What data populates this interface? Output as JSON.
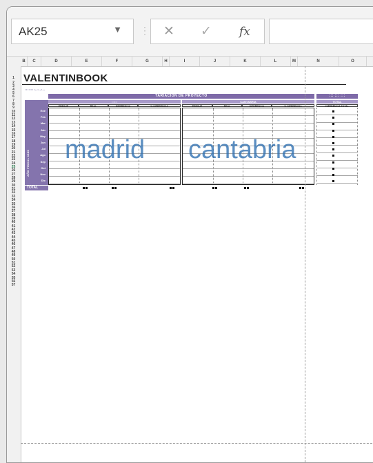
{
  "formula_bar": {
    "name_box": "AK25",
    "name_box_dropdown": "▼",
    "separator": "⋮",
    "cancel": "✕",
    "enter": "✓",
    "fx": "fx",
    "formula": ""
  },
  "columns": [
    "B",
    "C",
    "D",
    "E",
    "F",
    "G",
    "H",
    "I",
    "J",
    "K",
    "L",
    "M",
    "N",
    "O"
  ],
  "rows": [
    "1",
    "2",
    "3",
    "4",
    "5",
    "6",
    "7",
    "8",
    "9",
    "10",
    "11",
    "12",
    "13",
    "14",
    "15",
    "16",
    "17",
    "18",
    "19",
    "20",
    "21",
    "22",
    "23",
    "24",
    "25",
    "26",
    "27",
    "28",
    "29",
    "30",
    "31",
    "32",
    "33",
    "34",
    "35",
    "36",
    "37",
    "38",
    "39",
    "40",
    "41",
    "42",
    "43",
    "44",
    "45",
    "46",
    "47",
    "48",
    "49",
    "50",
    "51",
    "52",
    "53",
    "54",
    "55",
    "56",
    "57"
  ],
  "active_row": "25",
  "sheet": {
    "title": "VALENTINBOOK",
    "subtitle": "::::::::--:--:--",
    "banner": "TARIACIÓN DE PROYECTO",
    "banner_right": "::: ::: :::",
    "group_left": "::::::",
    "group_mid": "CANTABRIA",
    "group_right": "TOTAL",
    "side_label": "AÑO FISCAL 1666",
    "col_headers": [
      "PRESUP",
      "REAL",
      "DIFERENCIA",
      "% DIFERENCIA",
      "PRESUP",
      "REAL",
      "DIFERENCIA",
      "% DIFERENCIA",
      "DIFERENCIA TOTAL"
    ],
    "months": [
      "Ene",
      "Feb",
      "Mar",
      "Abr",
      "May",
      "Jun",
      "Jul",
      "Ago",
      "Sep",
      "Oct",
      "Nov",
      "Dic"
    ],
    "total_label": "TOTAL",
    "overlay_left": "madrid",
    "overlay_right": "cantabria"
  }
}
